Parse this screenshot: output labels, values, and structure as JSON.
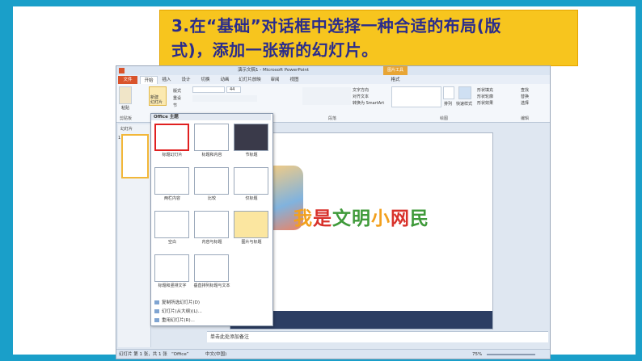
{
  "title": {
    "line1": "3.在“基础”对话框中选择一种合适的布局(版",
    "line2": "式)，添加一张新的幻灯片。"
  },
  "window": {
    "title": "演示文稿1 - Microsoft PowerPoint",
    "context_tab": "图片工具"
  },
  "tabs": [
    "文件",
    "开始",
    "插入",
    "设计",
    "切换",
    "动画",
    "幻灯片放映",
    "审阅",
    "视图",
    "格式"
  ],
  "ribbon": {
    "paste": "粘贴",
    "new_slide": "新建\n幻灯片",
    "layout": "版式",
    "reset": "重设",
    "section": "节",
    "clipboard_group": "剪贴板",
    "paragraph_group": "段落",
    "drawing_group": "绘图",
    "editing_group": "编辑",
    "font_size": "44",
    "text_direction": "文字方向",
    "align_text": "对齐文本",
    "smartart": "转换为 SmartArt",
    "arrange": "排列",
    "quick_styles": "快速样式",
    "shape_fill": "形状填充",
    "shape_outline": "形状轮廓",
    "shape_effects": "形状效果",
    "find": "查找",
    "replace": "替换",
    "select": "选择"
  },
  "pane": {
    "tab_slides": "幻灯片",
    "slide_num": "1"
  },
  "dropdown": {
    "header": "Office 主题",
    "layouts": [
      "标题幻灯片",
      "标题和内容",
      "节标题",
      "两栏内容",
      "比较",
      "仅标题",
      "空白",
      "内容与标题",
      "图片与标题",
      "标题和竖排文字",
      "垂直排列标题与文本"
    ],
    "actions": [
      "复制所选幻灯片(D)",
      "幻灯片(从大纲)(L)...",
      "重用幻灯片(R)..."
    ]
  },
  "slide_title_chars": [
    {
      "ch": "我",
      "color": "#f2a01d"
    },
    {
      "ch": "是",
      "color": "#d8312a"
    },
    {
      "ch": "文",
      "color": "#3f9a3a"
    },
    {
      "ch": "明",
      "color": "#3f9a3a"
    },
    {
      "ch": "小",
      "color": "#f2a01d"
    },
    {
      "ch": "网",
      "color": "#d8312a"
    },
    {
      "ch": "民",
      "color": "#3f9a3a"
    }
  ],
  "notes_placeholder": "单击此处添加备注",
  "status": {
    "slide_info": "幻灯片 第 1 张，共 1 张",
    "theme": "“Office”",
    "language": "中文(中国)",
    "zoom": "75%"
  },
  "colors": {
    "accent": "#1a9fc9",
    "title_bg": "#f7c51e",
    "title_text": "#2a2c8c",
    "file_tab": "#d9532b"
  }
}
